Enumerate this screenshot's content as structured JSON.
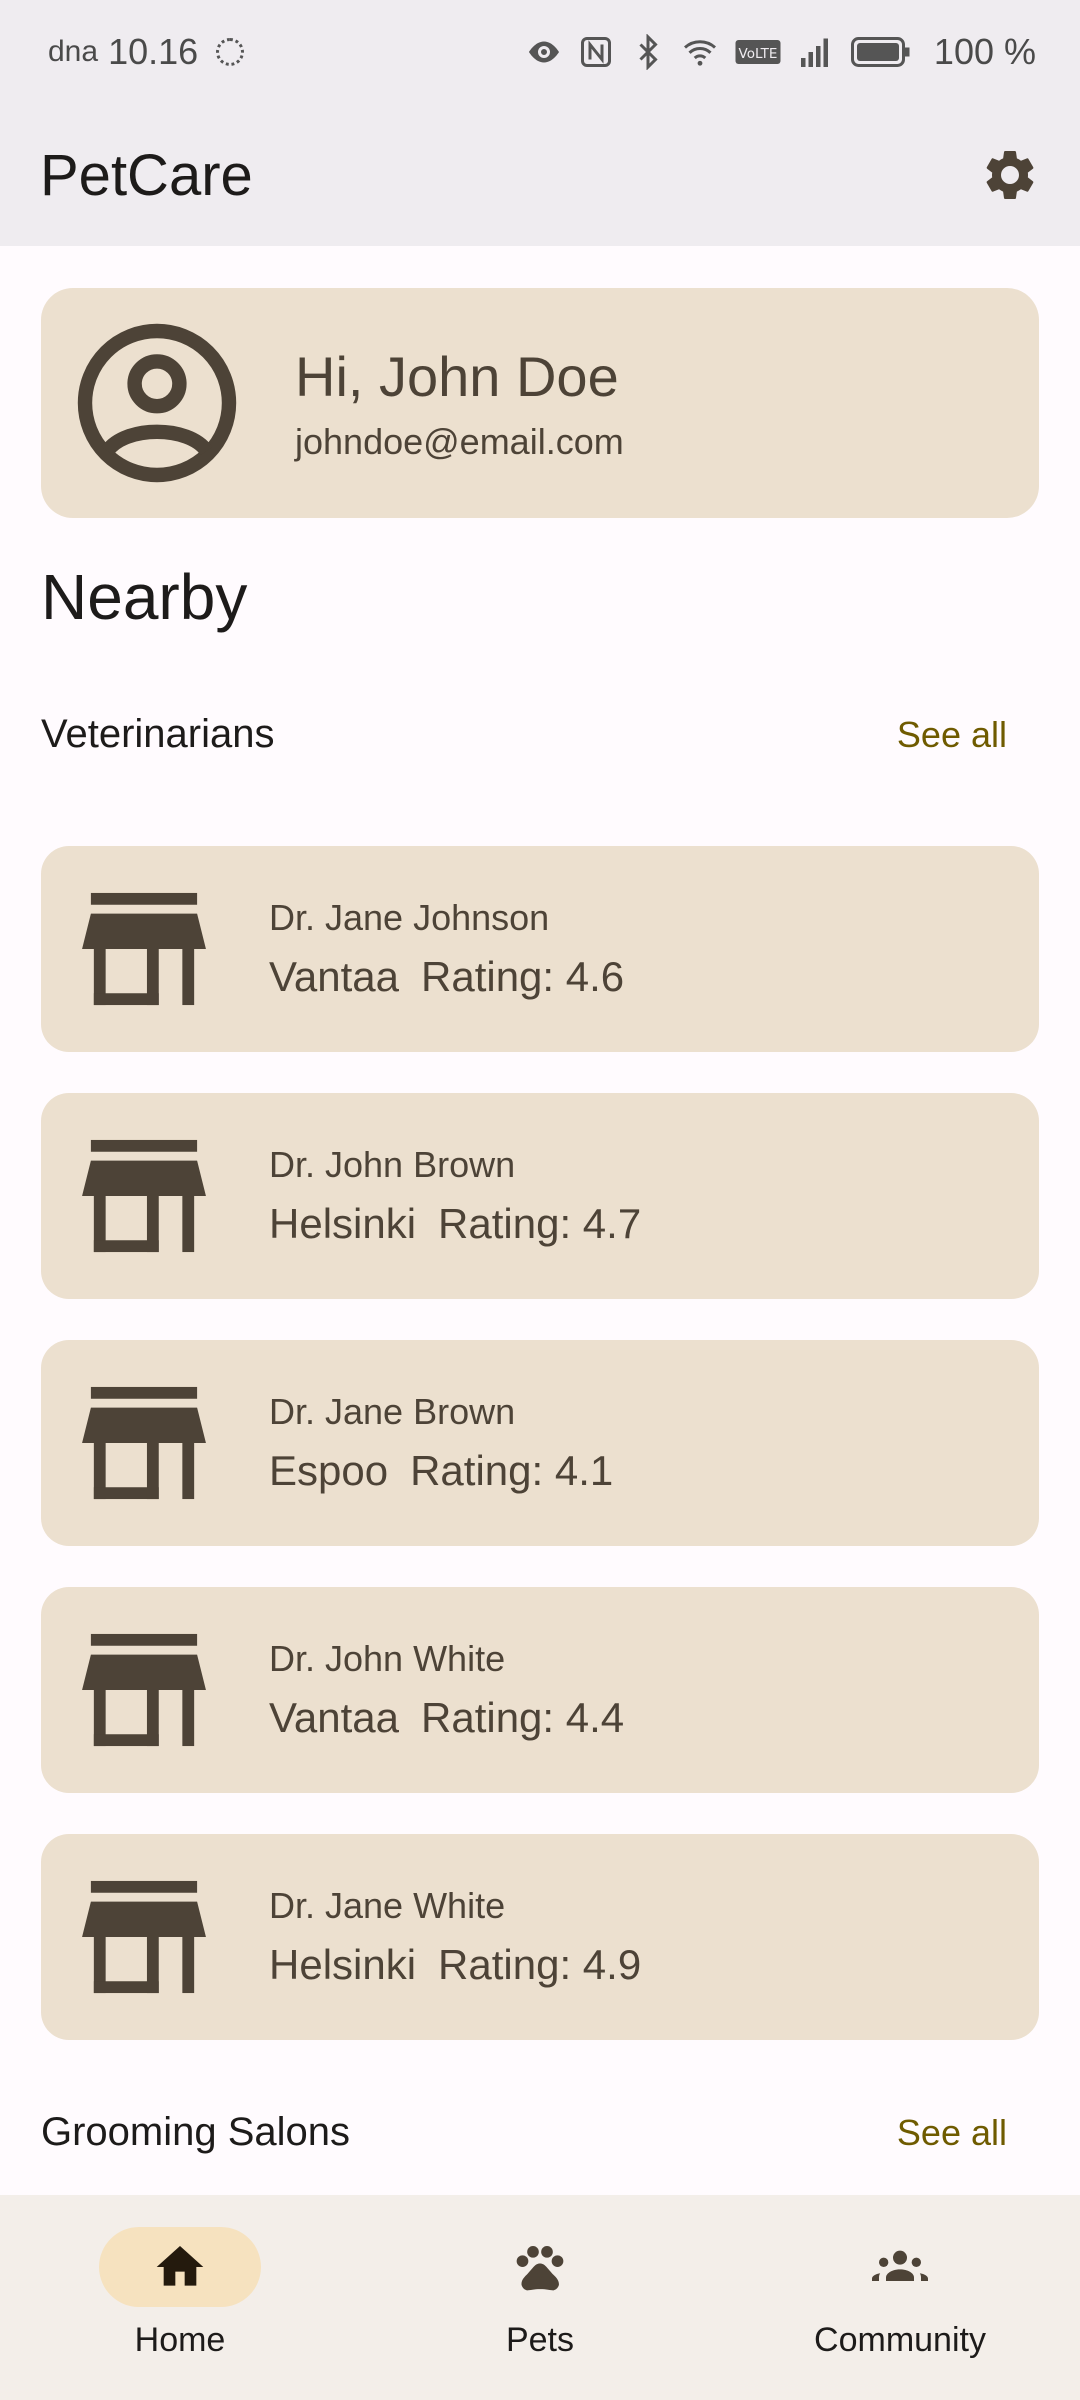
{
  "status_bar": {
    "carrier": "dna",
    "time": "10.16",
    "battery": "100 %",
    "icons": [
      "eye-icon",
      "nfc-icon",
      "bluetooth-icon",
      "wifi-icon",
      "volte-icon",
      "signal-icon",
      "battery-icon"
    ]
  },
  "app_bar": {
    "title": "PetCare",
    "settings_icon": "gear-icon"
  },
  "profile": {
    "greeting": "Hi, John Doe",
    "email": "johndoe@email.com",
    "avatar_icon": "account-circle-icon"
  },
  "nearby": {
    "title": "Nearby",
    "veterinarians": {
      "label": "Veterinarians",
      "see_all": "See all",
      "items": [
        {
          "name": "Dr. Jane Johnson",
          "city": "Vantaa",
          "rating": "Rating: 4.6"
        },
        {
          "name": "Dr. John Brown",
          "city": "Helsinki",
          "rating": "Rating: 4.7"
        },
        {
          "name": "Dr. Jane Brown",
          "city": "Espoo",
          "rating": "Rating: 4.1"
        },
        {
          "name": "Dr. John White",
          "city": "Vantaa",
          "rating": "Rating: 4.4"
        },
        {
          "name": "Dr. Jane White",
          "city": "Helsinki",
          "rating": "Rating: 4.9"
        }
      ]
    },
    "grooming": {
      "label": "Grooming Salons",
      "see_all": "See all"
    }
  },
  "bottom_nav": {
    "items": [
      {
        "label": "Home",
        "icon": "home-icon",
        "active": true
      },
      {
        "label": "Pets",
        "icon": "paw-icon",
        "active": false
      },
      {
        "label": "Community",
        "icon": "groups-icon",
        "active": false
      }
    ]
  },
  "colors": {
    "card_bg": "#ece0cf",
    "accent_text": "#6f5b00",
    "nav_active_pill": "#f6e2bf"
  }
}
